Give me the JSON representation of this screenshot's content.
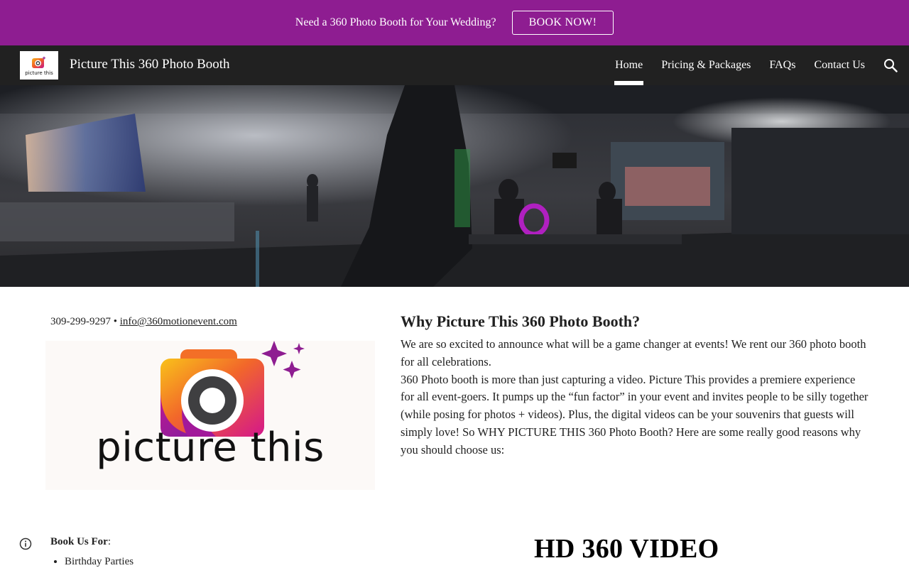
{
  "announcement": {
    "text": "Need a 360 Photo Booth for Your Wedding?",
    "button_label": "BOOK NOW!",
    "background": "#8e1d91"
  },
  "header": {
    "logo_icon": "camera-logo-icon",
    "logo_mini_text": "picture this",
    "site_title": "Picture This 360 Photo Booth",
    "nav_items": [
      {
        "label": "Home",
        "active": true
      },
      {
        "label": "Pricing & Packages",
        "active": false
      },
      {
        "label": "FAQs",
        "active": false
      },
      {
        "label": "Contact Us",
        "active": false
      }
    ],
    "search_icon": "search-icon"
  },
  "contact": {
    "phone": "309-299-9297",
    "separator": " • ",
    "email": "info@360motionevent.com"
  },
  "brand_card": {
    "wordmark": "picture this",
    "icon": "camera-logo-icon"
  },
  "why": {
    "heading": "Why Picture This 360 Photo Booth?",
    "paragraph_1": "We are so excited to announce what will be a game changer at events! We rent our 360 photo booth for all celebrations.",
    "paragraph_2": "360 Photo booth is more than just capturing a video. Picture This provides a premiere experience for all event-goers. It pumps up the “fun factor” in your event and invites people to be silly together (while posing for photos + videos). Plus, the digital videos can be your souvenirs that guests will simply love! So WHY PICTURE THIS 360 Photo Booth? Here are some really good reasons why you should choose us:"
  },
  "book": {
    "label_bold": "Book Us For",
    "label_suffix": ":",
    "items": [
      "Birthday Parties"
    ]
  },
  "hd_heading": "HD 360 VIDEO",
  "colors": {
    "accent_purple": "#8e1d91",
    "nav_bg": "#212121",
    "text": "#212121"
  }
}
